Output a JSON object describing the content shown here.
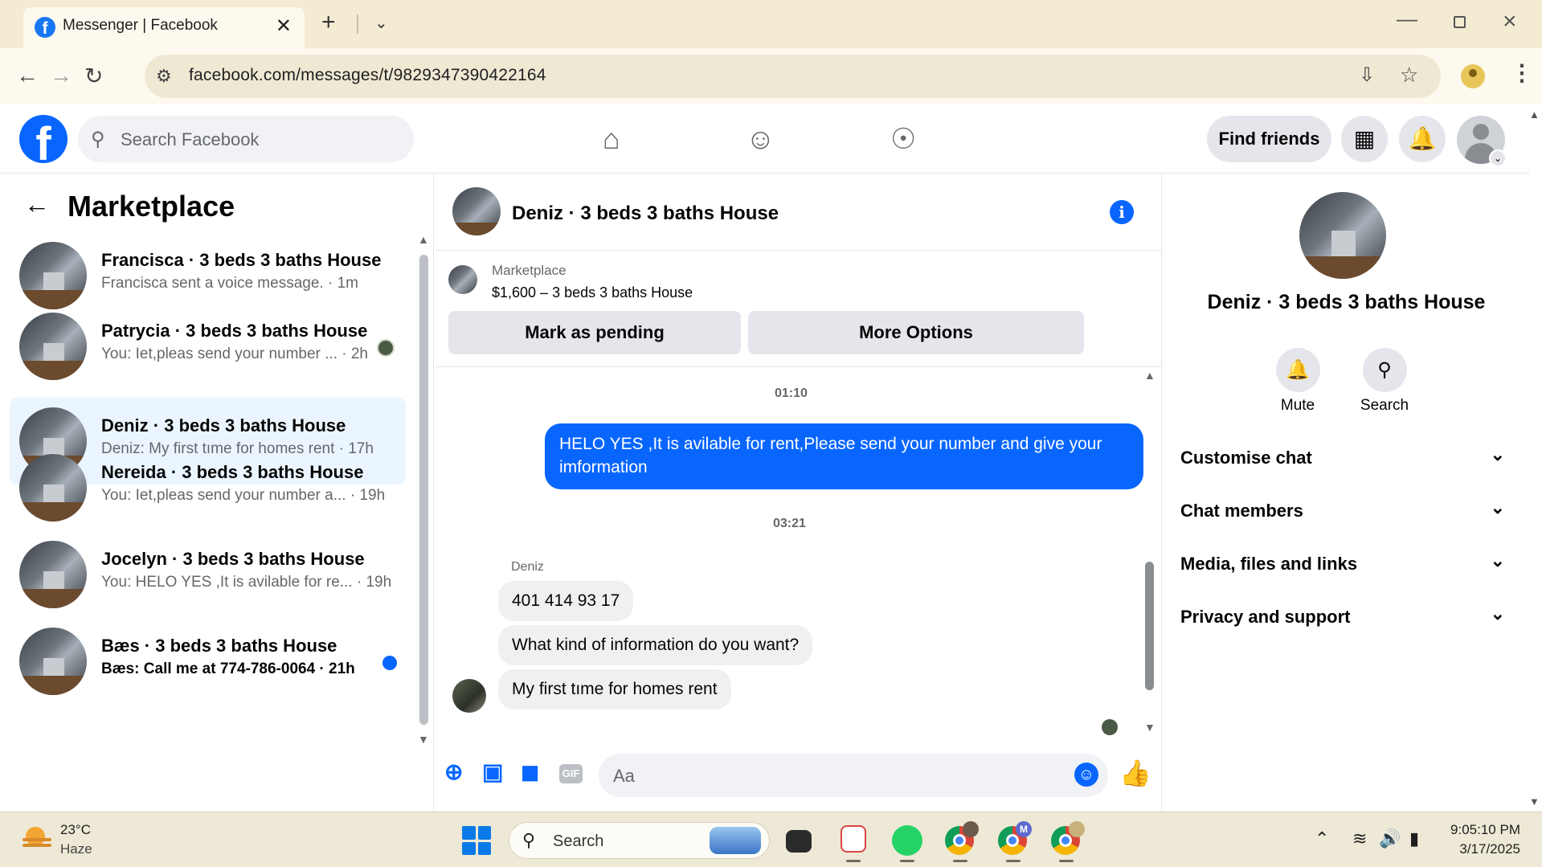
{
  "browser": {
    "tab_title": "Messenger | Facebook",
    "tab_close": "✕",
    "new_tab": "+",
    "tab_list": "⌄",
    "url": "facebook.com/messages/t/9829347390422164"
  },
  "fb_header": {
    "logo": "f",
    "search_placeholder": "Search Facebook",
    "find_friends": "Find friends"
  },
  "sidebar": {
    "back": "←",
    "title": "Marketplace",
    "conversations": [
      {
        "name": "Francisca · 3 beds 3 baths House",
        "preview": "Francisca sent a voice message. · 1m"
      },
      {
        "name": "Patrycia · 3 beds 3 baths House",
        "preview": "You: Iet,pleas send your number ... · 2h"
      },
      {
        "name": "Deniz · 3 beds 3 baths House",
        "preview": "Deniz: My first tıme for homes rent · 17h"
      },
      {
        "name": "Nereida · 3 beds 3 baths House",
        "preview": "You: Iet,pleas send your number a... · 19h"
      },
      {
        "name": "Jocelyn · 3 beds 3 baths House",
        "preview": "You: HELO YES ,It is avilable for re... · 19h"
      },
      {
        "name": "Bæs · 3 beds 3 baths House",
        "preview": "Bæs: Call me at 774-786-0064 · 21h"
      }
    ]
  },
  "chat": {
    "title": "Deniz · 3 beds 3 baths House",
    "info_icon": "i",
    "marketplace_label": "Marketplace",
    "listing": "$1,600 – 3 beds 3 baths House",
    "mark_pending": "Mark as pending",
    "more_options": "More Options",
    "time1": "01:10",
    "outgoing_message": "HELO YES ,It is avilable for rent,Please send your number and give your imformation",
    "time2": "03:21",
    "sender_name": "Deniz",
    "incoming": [
      "401 414 93 17",
      "What kind of information do you want?",
      "My first tıme for homes rent"
    ],
    "composer_placeholder": "Aa",
    "gif": "GIF"
  },
  "info_panel": {
    "name": "Deniz · 3 beds 3 baths House",
    "mute": "Mute",
    "search": "Search",
    "rows": [
      "Customise chat",
      "Chat members",
      "Media, files and links",
      "Privacy and support"
    ]
  },
  "taskbar": {
    "temperature": "23°C",
    "condition": "Haze",
    "search_placeholder": "Search",
    "time": "9:05:10 PM",
    "date": "3/17/2025",
    "badge_m": "M"
  },
  "colors": {
    "fb_blue": "#0866ff",
    "active_conversation": "#ebf5ff",
    "bubble_incoming": "#f0f0f0"
  }
}
